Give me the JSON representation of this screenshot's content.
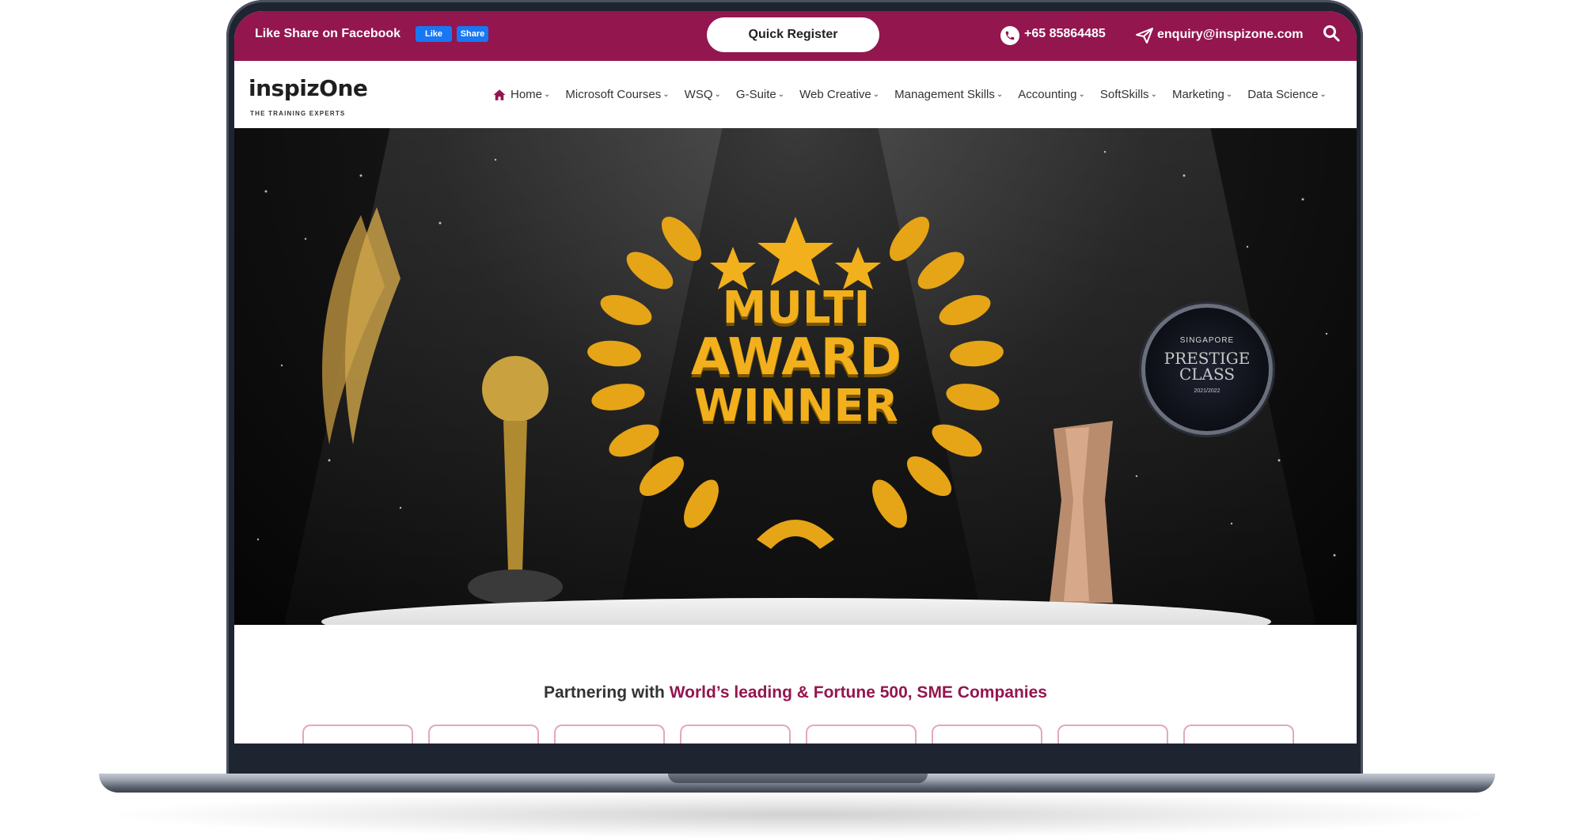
{
  "topbar": {
    "fb_text": "Like Share on Facebook",
    "like_label": "Like",
    "share_label": "Share",
    "quick_register": "Quick Register",
    "phone": "+65 85864485",
    "email": "enquiry@inspizone.com"
  },
  "logo": {
    "brand": "inspizOne",
    "tagline": "THE TRAINING EXPERTS"
  },
  "nav": {
    "items": [
      {
        "label": "Home"
      },
      {
        "label": "Microsoft Courses"
      },
      {
        "label": "WSQ"
      },
      {
        "label": "G-Suite"
      },
      {
        "label": "Web Creative"
      },
      {
        "label": "Management Skills"
      },
      {
        "label": "Accounting"
      },
      {
        "label": "SoftSkills"
      },
      {
        "label": "Marketing"
      },
      {
        "label": "Data Science"
      }
    ]
  },
  "hero": {
    "line1": "MULTI",
    "line2": "AWARD",
    "line3": "WINNER",
    "badge_top": "SINGAPORE",
    "badge_line1": "PRESTIGE",
    "badge_line2": "CLASS",
    "badge_year": "2021/2022"
  },
  "partners": {
    "title_prefix": "Partnering with ",
    "title_highlight": "World’s leading & Fortune 500, SME Companies"
  },
  "colors": {
    "brand": "#93164f",
    "award_gold": "#f2b01c",
    "facebook": "#1877f2"
  }
}
